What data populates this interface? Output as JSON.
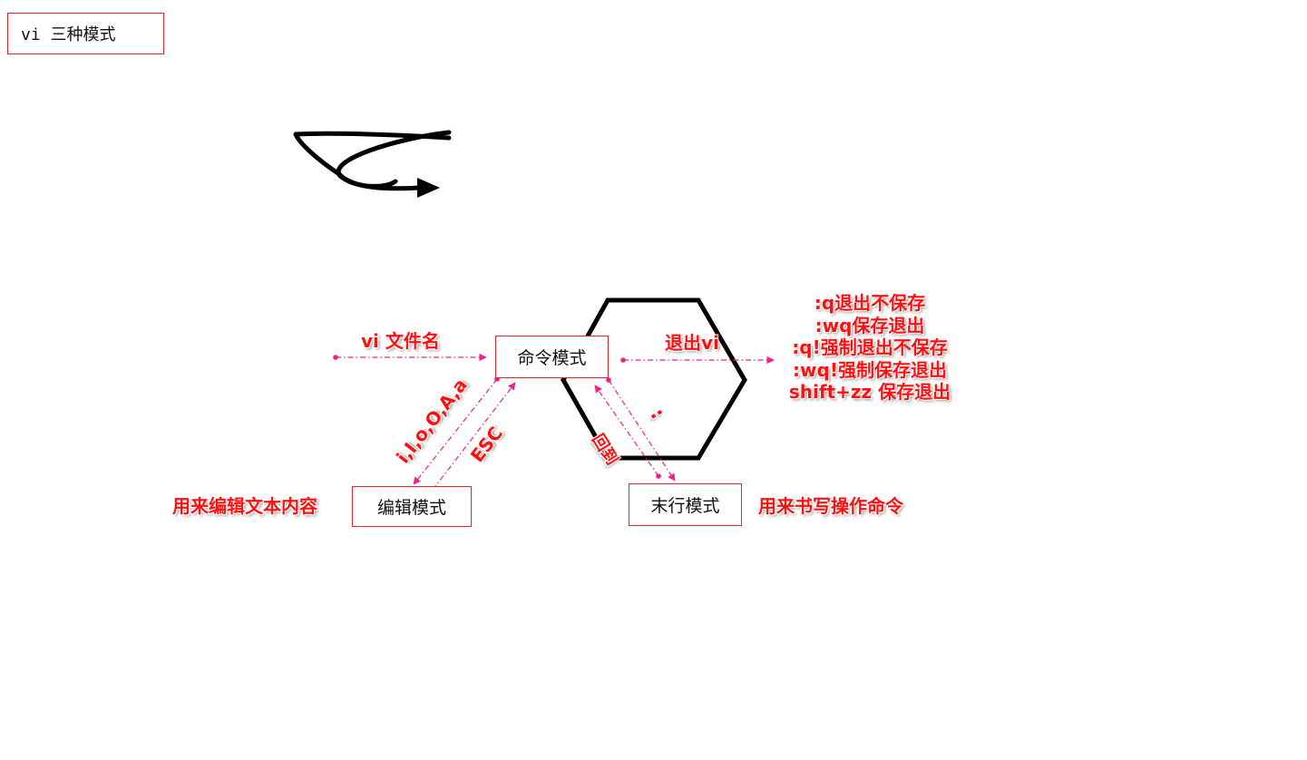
{
  "title": "vi  三种模式",
  "modes": {
    "command": "命令模式",
    "edit": "编辑模式",
    "last_line": "末行模式"
  },
  "labels": {
    "open_file": "vi  文件名",
    "insert_keys": "i,I,o,O,A,a",
    "esc": "ESC",
    "colon": ":",
    "back": "回到",
    "exit_vi": "退出vi",
    "edit_desc": "用来编辑文本内容",
    "last_desc": "用来书写操作命令"
  },
  "exit_commands": [
    ":q退出不保存",
    ":wq保存退出",
    ":q!强制退出不保存",
    ":wq!强制保存退出",
    "shift+zz  保存退出"
  ],
  "colors": {
    "box_border": "#e8202a",
    "label_red": "#ff1010",
    "arrow_pink": "#f0208a",
    "ink": "#000000"
  }
}
